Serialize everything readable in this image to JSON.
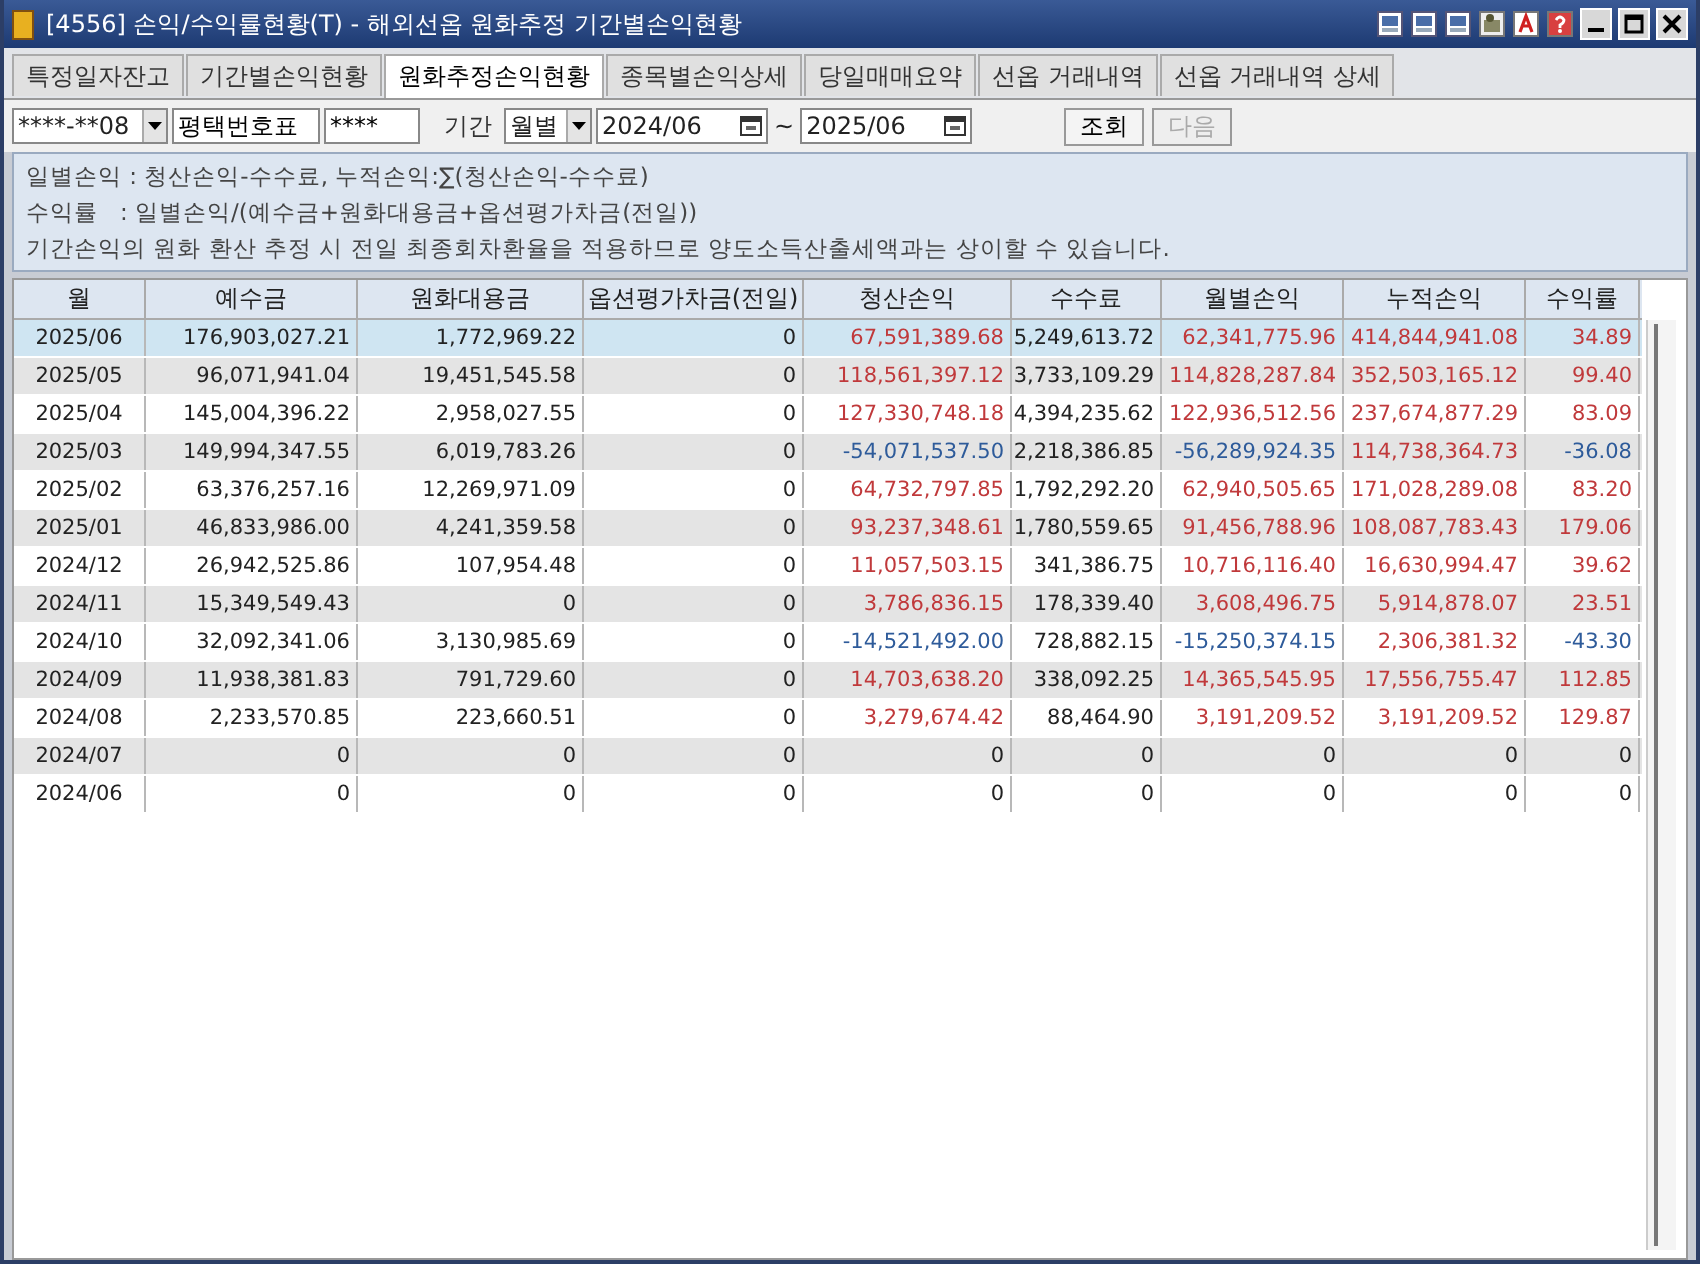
{
  "window": {
    "title": "[4556] 손익/수익률현황(T) - 해외선옵 원화추정 기간별손익현황"
  },
  "tabs": [
    {
      "label": "특정일자잔고",
      "selected": false
    },
    {
      "label": "기간별손익현황",
      "selected": false
    },
    {
      "label": "원화추정손익현황",
      "selected": true
    },
    {
      "label": "종목별손익상세",
      "selected": false
    },
    {
      "label": "당일매매요약",
      "selected": false
    },
    {
      "label": "선옵 거래내역",
      "selected": false
    },
    {
      "label": "선옵 거래내역 상세",
      "selected": false
    }
  ],
  "toolbar": {
    "account": "****-**08",
    "account_name": "평택번호표",
    "password": "****",
    "period_label": "기간",
    "period": "월별",
    "date_from": "2024/06",
    "date_separator": "~",
    "date_to": "2025/06",
    "buttons": [
      {
        "label": "조회",
        "disabled": false
      },
      {
        "label": "다음",
        "disabled": true
      }
    ]
  },
  "notes": [
    "일별손익 : 청산손익-수수료, 누적손익:∑(청산손익-수수료)",
    "수익률   : 일별손익/(예수금+원화대용금+옵션평가차금(전일))",
    "기간손익의 원화 환산 추정 시 전일 최종회차환율을 적용하므로 양도소득산출세액과는 상이할 수 있습니다."
  ],
  "table": {
    "columns": [
      "월",
      "예수금",
      "원화대용금",
      "옵션평가차금(전일)",
      "청산손익",
      "수수료",
      "월별손익",
      "누적손익",
      "수익률"
    ],
    "rows": [
      {
        "selected": true,
        "cells": [
          {
            "text": "2025/06"
          },
          {
            "text": "176,903,027.21"
          },
          {
            "text": "1,772,969.22"
          },
          {
            "text": "0"
          },
          {
            "text": "67,591,389.68",
            "color": "#c0393b"
          },
          {
            "text": "5,249,613.72"
          },
          {
            "text": "62,341,775.96",
            "color": "#c0393b"
          },
          {
            "text": "414,844,941.08",
            "color": "#c0393b"
          },
          {
            "text": "34.89",
            "color": "#c0393b"
          }
        ]
      },
      {
        "selected": false,
        "cells": [
          {
            "text": "2025/05"
          },
          {
            "text": "96,071,941.04"
          },
          {
            "text": "19,451,545.58"
          },
          {
            "text": "0"
          },
          {
            "text": "118,561,397.12",
            "color": "#c0393b"
          },
          {
            "text": "3,733,109.29"
          },
          {
            "text": "114,828,287.84",
            "color": "#c0393b"
          },
          {
            "text": "352,503,165.12",
            "color": "#c0393b"
          },
          {
            "text": "99.40",
            "color": "#c0393b"
          }
        ]
      },
      {
        "selected": false,
        "cells": [
          {
            "text": "2025/04"
          },
          {
            "text": "145,004,396.22"
          },
          {
            "text": "2,958,027.55"
          },
          {
            "text": "0"
          },
          {
            "text": "127,330,748.18",
            "color": "#c0393b"
          },
          {
            "text": "4,394,235.62"
          },
          {
            "text": "122,936,512.56",
            "color": "#c0393b"
          },
          {
            "text": "237,674,877.29",
            "color": "#c0393b"
          },
          {
            "text": "83.09",
            "color": "#c0393b"
          }
        ]
      },
      {
        "selected": false,
        "cells": [
          {
            "text": "2025/03"
          },
          {
            "text": "149,994,347.55"
          },
          {
            "text": "6,019,783.26"
          },
          {
            "text": "0"
          },
          {
            "text": "-54,071,537.50",
            "color": "#2e5b9a"
          },
          {
            "text": "2,218,386.85"
          },
          {
            "text": "-56,289,924.35",
            "color": "#2e5b9a"
          },
          {
            "text": "114,738,364.73",
            "color": "#c0393b"
          },
          {
            "text": "-36.08",
            "color": "#2e5b9a"
          }
        ]
      },
      {
        "selected": false,
        "cells": [
          {
            "text": "2025/02"
          },
          {
            "text": "63,376,257.16"
          },
          {
            "text": "12,269,971.09"
          },
          {
            "text": "0"
          },
          {
            "text": "64,732,797.85",
            "color": "#c0393b"
          },
          {
            "text": "1,792,292.20"
          },
          {
            "text": "62,940,505.65",
            "color": "#c0393b"
          },
          {
            "text": "171,028,289.08",
            "color": "#c0393b"
          },
          {
            "text": "83.20",
            "color": "#c0393b"
          }
        ]
      },
      {
        "selected": false,
        "cells": [
          {
            "text": "2025/01"
          },
          {
            "text": "46,833,986.00"
          },
          {
            "text": "4,241,359.58"
          },
          {
            "text": "0"
          },
          {
            "text": "93,237,348.61",
            "color": "#c0393b"
          },
          {
            "text": "1,780,559.65"
          },
          {
            "text": "91,456,788.96",
            "color": "#c0393b"
          },
          {
            "text": "108,087,783.43",
            "color": "#c0393b"
          },
          {
            "text": "179.06",
            "color": "#c0393b"
          }
        ]
      },
      {
        "selected": false,
        "cells": [
          {
            "text": "2024/12"
          },
          {
            "text": "26,942,525.86"
          },
          {
            "text": "107,954.48"
          },
          {
            "text": "0"
          },
          {
            "text": "11,057,503.15",
            "color": "#c0393b"
          },
          {
            "text": "341,386.75"
          },
          {
            "text": "10,716,116.40",
            "color": "#c0393b"
          },
          {
            "text": "16,630,994.47",
            "color": "#c0393b"
          },
          {
            "text": "39.62",
            "color": "#c0393b"
          }
        ]
      },
      {
        "selected": false,
        "cells": [
          {
            "text": "2024/11"
          },
          {
            "text": "15,349,549.43"
          },
          {
            "text": "0"
          },
          {
            "text": "0"
          },
          {
            "text": "3,786,836.15",
            "color": "#c0393b"
          },
          {
            "text": "178,339.40"
          },
          {
            "text": "3,608,496.75",
            "color": "#c0393b"
          },
          {
            "text": "5,914,878.07",
            "color": "#c0393b"
          },
          {
            "text": "23.51",
            "color": "#c0393b"
          }
        ]
      },
      {
        "selected": false,
        "cells": [
          {
            "text": "2024/10"
          },
          {
            "text": "32,092,341.06"
          },
          {
            "text": "3,130,985.69"
          },
          {
            "text": "0"
          },
          {
            "text": "-14,521,492.00",
            "color": "#2e5b9a"
          },
          {
            "text": "728,882.15"
          },
          {
            "text": "-15,250,374.15",
            "color": "#2e5b9a"
          },
          {
            "text": "2,306,381.32",
            "color": "#c0393b"
          },
          {
            "text": "-43.30",
            "color": "#2e5b9a"
          }
        ]
      },
      {
        "selected": false,
        "cells": [
          {
            "text": "2024/09"
          },
          {
            "text": "11,938,381.83"
          },
          {
            "text": "791,729.60"
          },
          {
            "text": "0"
          },
          {
            "text": "14,703,638.20",
            "color": "#c0393b"
          },
          {
            "text": "338,092.25"
          },
          {
            "text": "14,365,545.95",
            "color": "#c0393b"
          },
          {
            "text": "17,556,755.47",
            "color": "#c0393b"
          },
          {
            "text": "112.85",
            "color": "#c0393b"
          }
        ]
      },
      {
        "selected": false,
        "cells": [
          {
            "text": "2024/08"
          },
          {
            "text": "2,233,570.85"
          },
          {
            "text": "223,660.51"
          },
          {
            "text": "0"
          },
          {
            "text": "3,279,674.42",
            "color": "#c0393b"
          },
          {
            "text": "88,464.90"
          },
          {
            "text": "3,191,209.52",
            "color": "#c0393b"
          },
          {
            "text": "3,191,209.52",
            "color": "#c0393b"
          },
          {
            "text": "129.87",
            "color": "#c0393b"
          }
        ]
      },
      {
        "selected": false,
        "cells": [
          {
            "text": "2024/07"
          },
          {
            "text": "0"
          },
          {
            "text": "0"
          },
          {
            "text": "0"
          },
          {
            "text": "0"
          },
          {
            "text": "0"
          },
          {
            "text": "0"
          },
          {
            "text": "0"
          },
          {
            "text": "0"
          }
        ]
      },
      {
        "selected": false,
        "cells": [
          {
            "text": "2024/06"
          },
          {
            "text": "0"
          },
          {
            "text": "0"
          },
          {
            "text": "0"
          },
          {
            "text": "0"
          },
          {
            "text": "0"
          },
          {
            "text": "0"
          },
          {
            "text": "0"
          },
          {
            "text": "0"
          }
        ]
      }
    ]
  }
}
